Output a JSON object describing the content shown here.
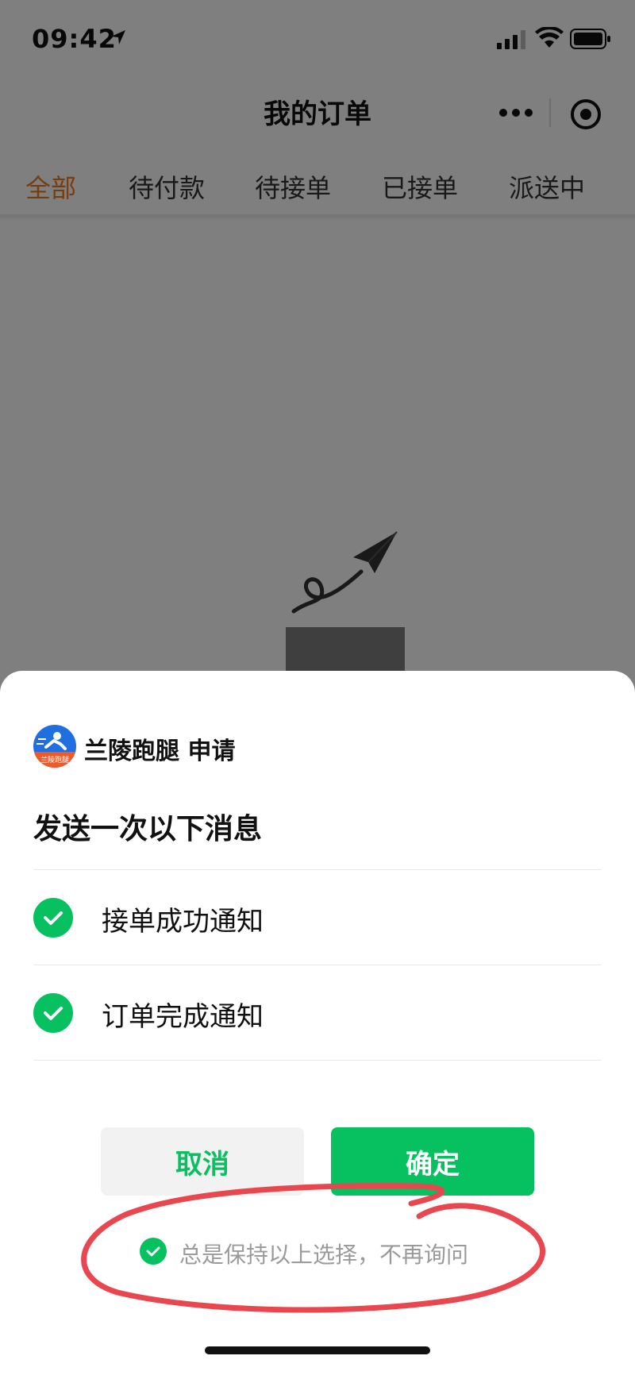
{
  "status_bar": {
    "time": "09:42"
  },
  "nav": {
    "title": "我的订单"
  },
  "tabs": [
    {
      "label": "全部",
      "active": true
    },
    {
      "label": "待付款",
      "active": false
    },
    {
      "label": "待接单",
      "active": false
    },
    {
      "label": "已接单",
      "active": false
    },
    {
      "label": "派送中",
      "active": false
    }
  ],
  "dialog": {
    "app_name": "兰陵跑腿 申请",
    "logo_text": "兰陵跑腿",
    "title": "发送一次以下消息",
    "items": [
      {
        "label": "接单成功通知",
        "checked": true
      },
      {
        "label": "订单完成通知",
        "checked": true
      }
    ],
    "cancel_label": "取消",
    "confirm_label": "确定",
    "always_label": "总是保持以上选择，不再询问",
    "always_checked": true
  },
  "colors": {
    "accent": "#07c160",
    "active_tab": "#f07a1a",
    "annotation": "#e8474f"
  }
}
